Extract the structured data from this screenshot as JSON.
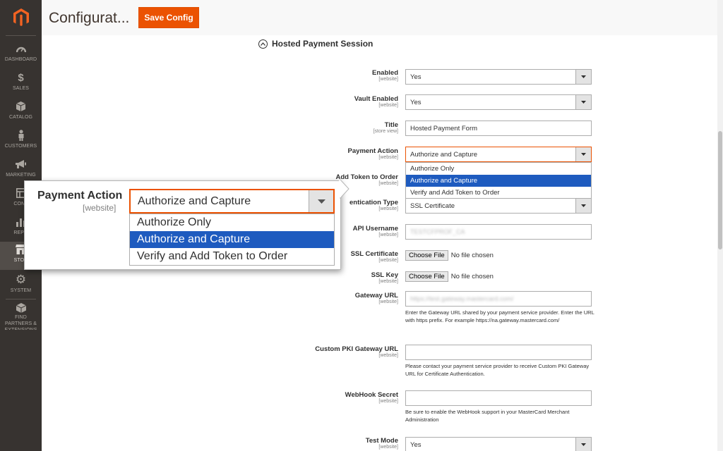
{
  "header": {
    "title": "Configurat...",
    "save_label": "Save Config"
  },
  "sidebar": {
    "items": [
      {
        "label": "DASHBOARD",
        "icon": "dashboard-icon"
      },
      {
        "label": "SALES",
        "icon": "dollar-icon"
      },
      {
        "label": "CATALOG",
        "icon": "box-icon"
      },
      {
        "label": "CUSTOMERS",
        "icon": "person-icon"
      },
      {
        "label": "MARKETING",
        "icon": "megaphone-icon"
      },
      {
        "label": "CONT",
        "icon": "layout-icon"
      },
      {
        "label": "REPO",
        "icon": "bar-chart-icon"
      },
      {
        "label": "STOR",
        "icon": "store-icon"
      },
      {
        "label": "SYSTEM",
        "icon": "gear-icon"
      },
      {
        "label": "FIND PARTNERS & EXTENSIONS",
        "icon": "cube-icon"
      }
    ]
  },
  "section": {
    "title": "Hosted Payment Session"
  },
  "fields": {
    "enabled": {
      "label": "Enabled",
      "scope": "[website]",
      "value": "Yes"
    },
    "vault_enabled": {
      "label": "Vault Enabled",
      "scope": "[website]",
      "value": "Yes"
    },
    "title": {
      "label": "Title",
      "scope": "[store view]",
      "value": "Hosted Payment Form"
    },
    "payment_action": {
      "label": "Payment Action",
      "scope": "[website]",
      "value": "Authorize and Capture",
      "options": [
        "Authorize Only",
        "Authorize and Capture",
        "Verify and Add Token to Order"
      ]
    },
    "add_token": {
      "label": "Add Token to Order",
      "scope": "[website]"
    },
    "auth_type": {
      "label": "Authentication Type",
      "label_visible": "entication Type",
      "scope": "[website]",
      "value": "SSL Certificate"
    },
    "api_username": {
      "label": "API Username",
      "scope": "[website]",
      "value": "TESTCFPROF_CA"
    },
    "ssl_cert": {
      "label": "SSL Certificate",
      "scope": "[website]",
      "button": "Choose File",
      "status": "No file chosen"
    },
    "ssl_key": {
      "label": "SSL Key",
      "scope": "[website]",
      "button": "Choose File",
      "status": "No file chosen"
    },
    "gateway_url": {
      "label": "Gateway URL",
      "scope": "[website]",
      "value": "https://test.gateway.mastercard.com/",
      "note": "Enter the Gateway URL shared by your payment service provider. Enter the URL with https prefix. For example https://na.gateway.mastercard.com/"
    },
    "pki_url": {
      "label": "Custom PKI Gateway URL",
      "scope": "[website]",
      "value": "",
      "note": "Please contact your payment service provider to receive Custom PKI Gateway URL for Certificate Authentication."
    },
    "webhook": {
      "label": "WebHook Secret",
      "scope": "[website]",
      "value": "",
      "note": "Be sure to enable the WebHook support in your MasterCard Merchant Administration"
    },
    "test_mode": {
      "label": "Test Mode",
      "scope": "[website]",
      "value": "Yes"
    }
  },
  "callout": {
    "label": "Payment Action",
    "scope": "[website]",
    "value": "Authorize and Capture",
    "options": [
      "Authorize Only",
      "Authorize and Capture",
      "Verify and Add Token to Order"
    ],
    "selected_index": 1
  },
  "colors": {
    "accent": "#eb5202",
    "sidebar": "#373330",
    "selected": "#1e5bbf"
  }
}
